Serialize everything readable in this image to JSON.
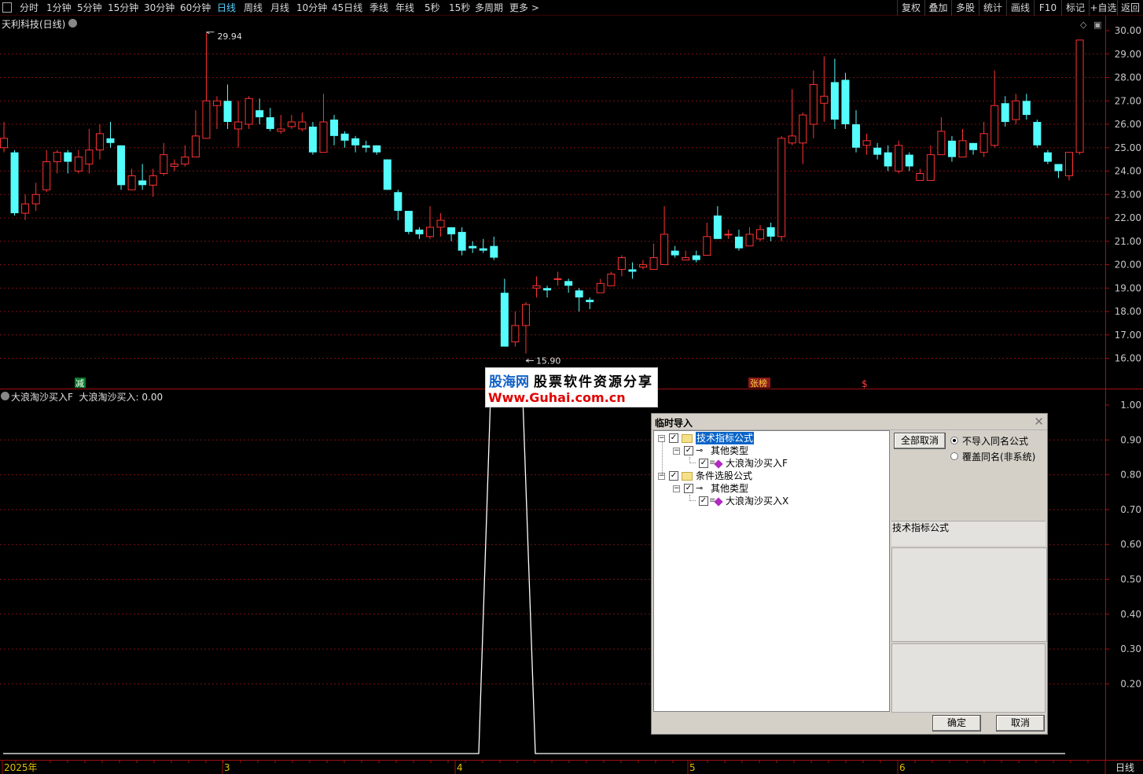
{
  "toolbar": {
    "left": [
      "分时",
      "1分钟",
      "5分钟",
      "15分钟",
      "30分钟",
      "60分钟",
      "日线",
      "周线",
      "月线",
      "10分钟",
      "45日线",
      "季线",
      "年线",
      "5秒",
      "15秒",
      "多周期",
      "更多 >"
    ],
    "active": "日线",
    "right": [
      "复权",
      "叠加",
      "多股",
      "统计",
      "画线",
      "F10",
      "标记",
      "+自选",
      "返回"
    ]
  },
  "stock": {
    "title": "天利科技(日线)",
    "high_label": "29.94",
    "low_label": "15.90"
  },
  "indicator": {
    "name": "大浪淘沙买入F",
    "value_label": "大浪淘沙买入: 0.00"
  },
  "price_axis": [
    "30.00",
    "29.00",
    "28.00",
    "27.00",
    "26.00",
    "25.00",
    "24.00",
    "23.00",
    "22.00",
    "21.00",
    "20.00",
    "19.00",
    "18.00",
    "17.00",
    "16.00"
  ],
  "ind_axis": [
    "1.00",
    "0.90",
    "0.80",
    "0.70",
    "0.60",
    "0.50",
    "0.40",
    "0.30",
    "0.20"
  ],
  "time_axis": [
    "2025年",
    "3",
    "4",
    "5",
    "6"
  ],
  "period_label": "日线",
  "markers": {
    "jian": "减",
    "zhangbang": "张榜",
    "dollar": "$"
  },
  "banner": {
    "line1_a": "股海网",
    "line1_b": "股票软件资源分享",
    "line2": "Www.Guhai.com.cn"
  },
  "dialog": {
    "title": "临时导入",
    "tree": [
      {
        "level": 0,
        "label": "技术指标公式",
        "type": "folder",
        "selected": true
      },
      {
        "level": 1,
        "label": "其他类型",
        "type": "key"
      },
      {
        "level": 2,
        "label": "大浪淘沙买入F",
        "type": "item"
      },
      {
        "level": 0,
        "label": "条件选股公式",
        "type": "folder"
      },
      {
        "level": 1,
        "label": "其他类型",
        "type": "key"
      },
      {
        "level": 2,
        "label": "大浪淘沙买入X",
        "type": "item"
      }
    ],
    "cancel_all": "全部取消",
    "radio_no_import": "不导入同名公式",
    "radio_overwrite": "覆盖同名(非系统)",
    "info_label": "技术指标公式",
    "ok": "确定",
    "cancel": "取消"
  },
  "chart_data": {
    "type": "candlestick",
    "x_months": [
      "2025年",
      "3",
      "4",
      "5",
      "6"
    ],
    "price_range": [
      15.5,
      30.3
    ],
    "candles": [
      [
        25.0,
        25.4,
        26.1,
        24.8
      ],
      [
        24.8,
        22.2,
        24.9,
        22.1
      ],
      [
        22.2,
        22.6,
        23.0,
        21.9
      ],
      [
        22.6,
        23.0,
        23.5,
        22.3
      ],
      [
        23.2,
        24.4,
        24.9,
        23.1
      ],
      [
        24.4,
        24.8,
        24.9,
        23.9
      ],
      [
        24.8,
        24.4,
        24.9,
        23.9
      ],
      [
        24.0,
        24.6,
        24.9,
        23.9
      ],
      [
        24.3,
        24.9,
        25.8,
        23.9
      ],
      [
        24.9,
        25.6,
        26.0,
        24.5
      ],
      [
        25.4,
        25.2,
        26.1,
        25.0
      ],
      [
        25.1,
        23.4,
        25.1,
        23.2
      ],
      [
        23.2,
        23.8,
        24.1,
        23.2
      ],
      [
        23.6,
        23.4,
        24.3,
        23.2
      ],
      [
        23.4,
        23.8,
        24.1,
        22.9
      ],
      [
        23.9,
        24.7,
        25.2,
        23.8
      ],
      [
        24.2,
        24.3,
        24.5,
        24.0
      ],
      [
        24.3,
        24.6,
        25.1,
        24.2
      ],
      [
        24.6,
        25.5,
        26.6,
        24.6
      ],
      [
        25.4,
        27.0,
        29.9,
        25.4
      ],
      [
        26.8,
        27.0,
        27.2,
        25.8
      ],
      [
        27.0,
        26.1,
        27.7,
        25.8
      ],
      [
        25.8,
        26.1,
        27.0,
        25.0
      ],
      [
        26.0,
        27.1,
        27.2,
        25.8
      ],
      [
        26.6,
        26.3,
        27.1,
        26.0
      ],
      [
        26.3,
        25.8,
        26.7,
        25.7
      ],
      [
        25.7,
        25.8,
        26.4,
        25.6
      ],
      [
        25.9,
        26.1,
        26.4,
        25.8
      ],
      [
        25.8,
        26.1,
        26.5,
        25.7
      ],
      [
        25.9,
        24.8,
        26.1,
        24.7
      ],
      [
        24.8,
        26.1,
        27.3,
        24.8
      ],
      [
        26.2,
        25.5,
        26.4,
        25.1
      ],
      [
        25.6,
        25.3,
        25.7,
        25.0
      ],
      [
        25.4,
        25.1,
        25.5,
        24.8
      ],
      [
        25.1,
        25.0,
        25.3,
        24.8
      ],
      [
        25.1,
        24.8,
        25.1,
        24.7
      ],
      [
        24.5,
        23.2,
        24.5,
        23.2
      ],
      [
        23.1,
        22.3,
        23.2,
        21.9
      ],
      [
        22.3,
        21.4,
        22.3,
        21.3
      ],
      [
        21.5,
        21.3,
        21.6,
        21.1
      ],
      [
        21.2,
        21.6,
        22.5,
        21.1
      ],
      [
        21.6,
        21.9,
        22.2,
        21.2
      ],
      [
        21.6,
        21.3,
        21.6,
        21.0
      ],
      [
        21.4,
        20.6,
        21.6,
        20.4
      ],
      [
        20.8,
        20.7,
        21.0,
        20.5
      ],
      [
        20.7,
        20.6,
        21.1,
        20.5
      ],
      [
        20.8,
        20.3,
        21.2,
        20.2
      ],
      [
        18.8,
        16.5,
        19.4,
        16.5
      ],
      [
        16.7,
        17.4,
        18.0,
        16.5
      ],
      [
        17.4,
        18.3,
        18.4,
        16.2
      ],
      [
        19.0,
        19.1,
        19.5,
        18.6
      ],
      [
        19.0,
        18.9,
        19.1,
        18.6
      ],
      [
        19.4,
        19.4,
        19.7,
        19.1
      ],
      [
        19.3,
        19.1,
        19.4,
        18.8
      ],
      [
        18.9,
        18.6,
        19.0,
        18.0
      ],
      [
        18.5,
        18.4,
        18.6,
        18.1
      ],
      [
        18.8,
        19.2,
        19.4,
        18.8
      ],
      [
        19.1,
        19.6,
        19.7,
        19.1
      ],
      [
        19.8,
        20.3,
        20.4,
        19.5
      ],
      [
        19.8,
        19.7,
        20.1,
        19.4
      ],
      [
        19.9,
        20.0,
        20.2,
        19.8
      ],
      [
        19.8,
        20.3,
        20.9,
        19.8
      ],
      [
        20.0,
        21.3,
        22.5,
        20.0
      ],
      [
        20.6,
        20.4,
        20.8,
        20.3
      ],
      [
        20.2,
        20.3,
        20.6,
        20.2
      ],
      [
        20.4,
        20.2,
        20.6,
        20.1
      ],
      [
        20.4,
        21.2,
        21.8,
        20.4
      ],
      [
        22.1,
        21.1,
        22.5,
        21.1
      ],
      [
        21.3,
        21.3,
        21.5,
        21.1
      ],
      [
        21.2,
        20.7,
        21.5,
        20.6
      ],
      [
        20.8,
        21.3,
        21.6,
        20.8
      ],
      [
        21.1,
        21.5,
        21.7,
        21.0
      ],
      [
        21.6,
        21.2,
        21.8,
        21.0
      ],
      [
        21.2,
        25.4,
        25.5,
        21.0
      ],
      [
        25.2,
        25.5,
        27.5,
        25.1
      ],
      [
        25.2,
        26.4,
        26.5,
        24.3
      ],
      [
        26.0,
        27.7,
        28.3,
        25.4
      ],
      [
        26.9,
        27.2,
        28.9,
        26.1
      ],
      [
        27.8,
        26.2,
        28.8,
        25.8
      ],
      [
        27.9,
        26.0,
        28.2,
        25.8
      ],
      [
        26.0,
        25.0,
        26.6,
        24.8
      ],
      [
        25.1,
        25.3,
        25.6,
        24.7
      ],
      [
        25.0,
        24.7,
        25.2,
        24.5
      ],
      [
        24.8,
        24.2,
        25.1,
        24.0
      ],
      [
        24.0,
        25.1,
        25.3,
        23.9
      ],
      [
        24.7,
        24.2,
        24.8,
        24.0
      ],
      [
        23.6,
        23.9,
        24.1,
        23.6
      ],
      [
        23.6,
        24.7,
        25.1,
        23.7
      ],
      [
        24.7,
        25.7,
        26.3,
        24.7
      ],
      [
        25.3,
        24.6,
        25.5,
        24.4
      ],
      [
        24.6,
        25.3,
        25.8,
        24.6
      ],
      [
        25.2,
        24.9,
        25.2,
        24.7
      ],
      [
        24.8,
        25.6,
        26.1,
        24.6
      ],
      [
        25.1,
        26.8,
        28.3,
        25.0
      ],
      [
        26.9,
        26.1,
        27.2,
        25.9
      ],
      [
        26.2,
        27.0,
        27.3,
        26.0
      ],
      [
        27.0,
        26.4,
        27.3,
        26.2
      ],
      [
        26.1,
        25.1,
        26.2,
        25.0
      ],
      [
        24.8,
        24.4,
        24.9,
        24.3
      ],
      [
        24.3,
        24.0,
        24.3,
        23.7
      ],
      [
        23.8,
        24.8,
        24.8,
        23.6
      ],
      [
        24.8,
        29.6,
        29.6,
        24.7
      ]
    ],
    "indicator": {
      "name": "大浪淘沙买入",
      "ylim": [
        0,
        1
      ],
      "baseline": 0.0,
      "pulse_level": 1.0
    }
  }
}
